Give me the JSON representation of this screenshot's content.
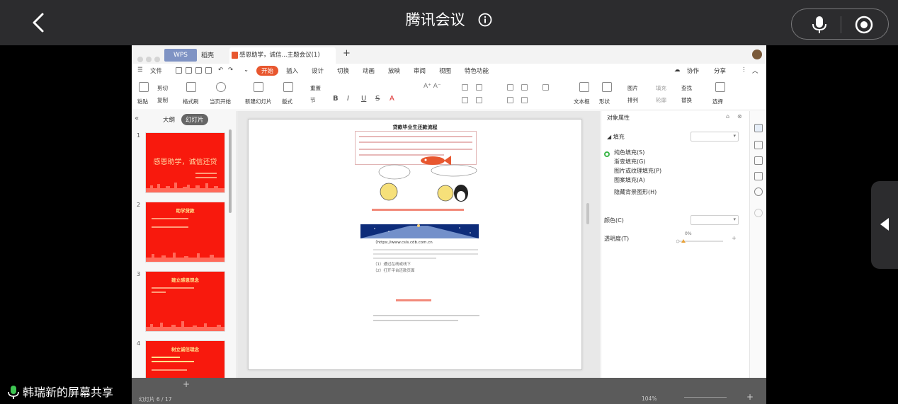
{
  "meeting": {
    "title": "腾讯会议",
    "sharer_label": "韩瑞新的屏幕共享"
  },
  "wps": {
    "tabs": {
      "wps": "WPS",
      "draft": "稻壳",
      "doc": "感恩助学，诚信...主题会议(1)"
    },
    "menu": [
      "文件",
      "开始",
      "插入",
      "设计",
      "切换",
      "动画",
      "放映",
      "审阅",
      "视图",
      "特色功能"
    ],
    "menu_active": "开始",
    "menu_right": {
      "collab": "协作",
      "share": "分享"
    },
    "ribbon": {
      "cut": "剪切",
      "copy": "复制",
      "format_painter": "格式刷",
      "paste": "粘贴",
      "from_current": "当页开始",
      "new_slide": "新建幻灯片",
      "layout": "版式",
      "section": "节",
      "reset": "重置",
      "textbox": "文本框",
      "shape": "形状",
      "arrange": "排列",
      "picture": "图片",
      "fill": "填充",
      "outline": "轮廓",
      "find": "查找",
      "replace": "替换",
      "select": "选择"
    },
    "left_panel": {
      "outline": "大纲",
      "slides": "幻灯片",
      "thumbs": [
        {
          "num": "1",
          "title": "感恩助学，诚信还贷"
        },
        {
          "num": "2",
          "title": "助学贷款"
        },
        {
          "num": "3",
          "title": "建立感恩观念"
        },
        {
          "num": "4",
          "title": "树立诚信理念"
        }
      ]
    },
    "slide": {
      "title": "贷款毕业生还款流程",
      "url_text": "（https://www.csls.cdb.com.cn",
      "step1": "（1）通过在线或线下",
      "step2": "（2）打开平台还款页面"
    },
    "right_panel": {
      "heading": "对象属性",
      "fill_section": "填充",
      "options": [
        "纯色填充(S)",
        "渐变填充(G)",
        "图片或纹理填充(P)",
        "图案填充(A)",
        "隐藏背景图形(H)"
      ],
      "color_label": "颜色(C)",
      "transparency_label": "透明度(T)",
      "transparency_value": "0%"
    },
    "status": {
      "slide_count": "幻灯片 6 / 17",
      "zoom": "104%"
    }
  }
}
